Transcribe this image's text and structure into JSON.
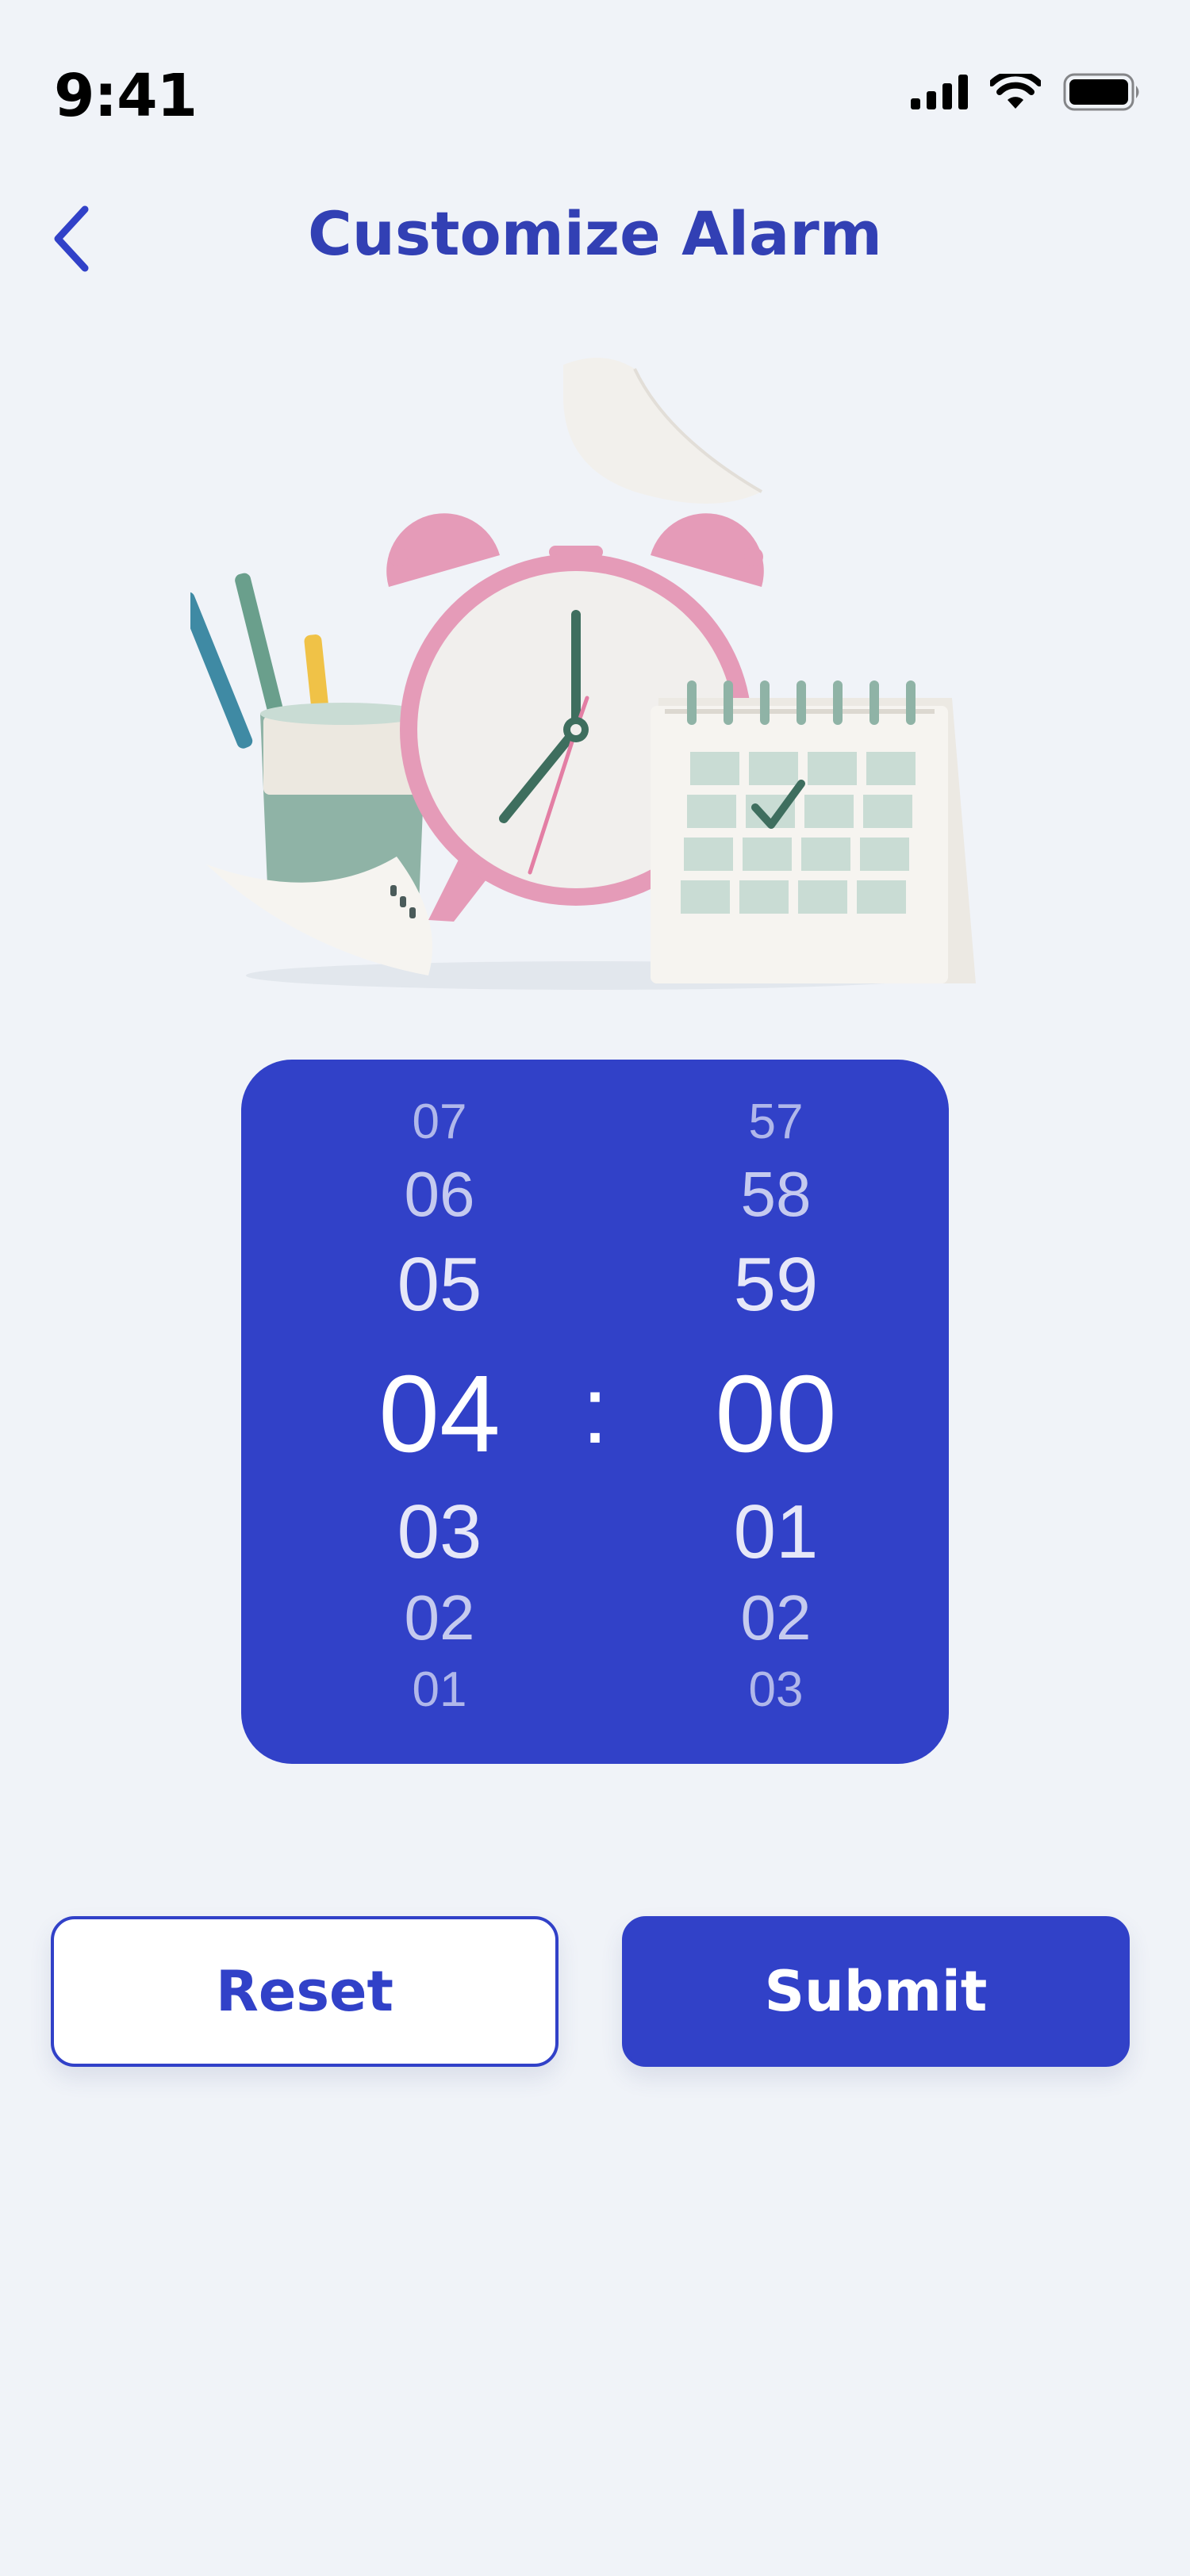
{
  "status_bar": {
    "time": "9:41",
    "icons": [
      "cellular-signal-icon",
      "wifi-icon",
      "battery-icon"
    ]
  },
  "header": {
    "back_icon": "chevron-left-icon",
    "title": "Customize Alarm"
  },
  "illustration": {
    "icons": [
      "alarm-clock-icon",
      "calendar-icon",
      "pencil-cup-icon",
      "paper-note-icon"
    ]
  },
  "time_picker": {
    "hours": [
      "07",
      "06",
      "05",
      "04",
      "03",
      "02",
      "01"
    ],
    "minutes": [
      "57",
      "58",
      "59",
      "00",
      "01",
      "02",
      "03"
    ],
    "separator": ":",
    "selected_hour": "04",
    "selected_minute": "00"
  },
  "actions": {
    "reset_label": "Reset",
    "submit_label": "Submit"
  },
  "colors": {
    "background": "#f0f3f8",
    "accent": "#3141c8",
    "title": "#3240b4",
    "clock_pink": "#e59bb8",
    "calendar_green": "#a9c8bc"
  }
}
